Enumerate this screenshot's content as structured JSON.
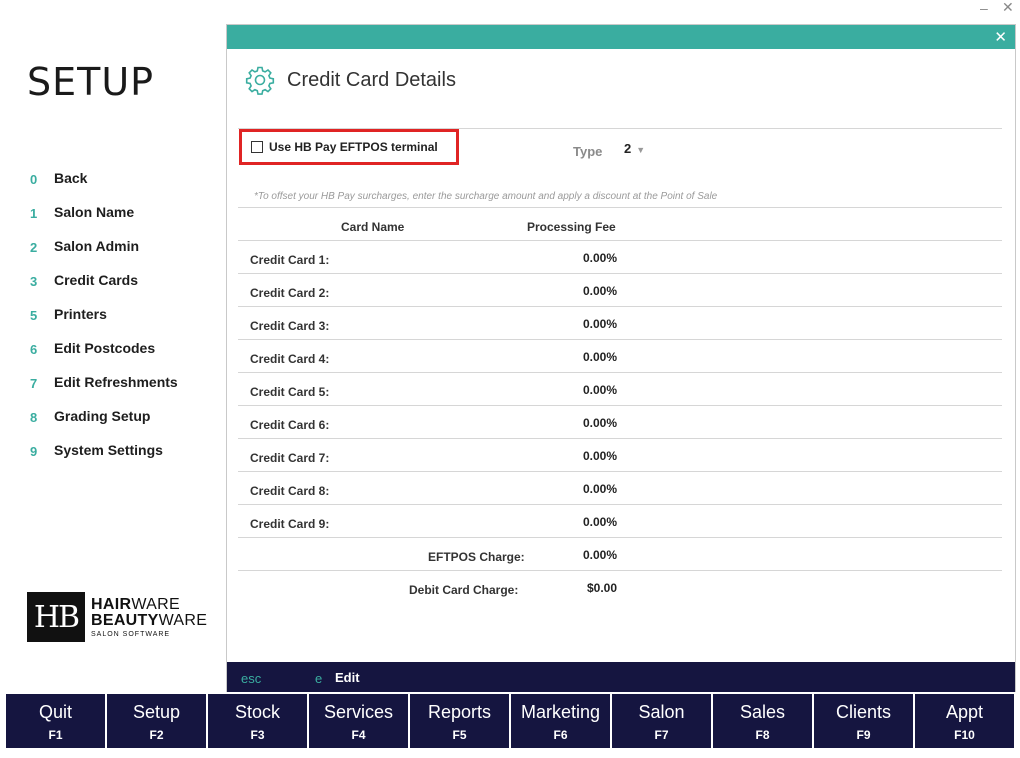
{
  "window": {
    "minimize_glyph": "–",
    "close_glyph": "✕"
  },
  "sidebar": {
    "title": "SETUP",
    "items": [
      {
        "key": "0",
        "label": "Back"
      },
      {
        "key": "1",
        "label": "Salon Name"
      },
      {
        "key": "2",
        "label": "Salon Admin"
      },
      {
        "key": "3",
        "label": "Credit Cards"
      },
      {
        "key": "5",
        "label": "Printers"
      },
      {
        "key": "6",
        "label": "Edit Postcodes"
      },
      {
        "key": "7",
        "label": "Edit Refreshments"
      },
      {
        "key": "8",
        "label": "Grading Setup"
      },
      {
        "key": "9",
        "label": "System Settings"
      }
    ],
    "logo": {
      "mark": "HB",
      "line1_bold": "HAIR",
      "line1_rest": "WARE",
      "line2_bold": "BEAUTY",
      "line2_rest": "WARE",
      "line3": "SALON SOFTWARE"
    }
  },
  "dialog": {
    "title": "Credit Card Details",
    "icon": "gear-icon",
    "close_glyph": "✕",
    "eftpos_checkbox": {
      "label": "Use HB Pay EFTPOS terminal",
      "checked": false
    },
    "type": {
      "label": "Type",
      "value": "2"
    },
    "note": "*To offset your HB Pay surcharges, enter the surcharge amount and apply a discount at the Point of Sale",
    "columns": {
      "card_name": "Card Name",
      "processing_fee": "Processing Fee"
    },
    "cards": [
      {
        "name": "Credit Card 1:",
        "fee": "0.00%"
      },
      {
        "name": "Credit Card 2:",
        "fee": "0.00%"
      },
      {
        "name": "Credit Card 3:",
        "fee": "0.00%"
      },
      {
        "name": "Credit Card 4:",
        "fee": "0.00%"
      },
      {
        "name": "Credit Card 5:",
        "fee": "0.00%"
      },
      {
        "name": "Credit Card 6:",
        "fee": "0.00%"
      },
      {
        "name": "Credit Card 7:",
        "fee": "0.00%"
      },
      {
        "name": "Credit Card 8:",
        "fee": "0.00%"
      },
      {
        "name": "Credit Card 9:",
        "fee": "0.00%"
      }
    ],
    "eftpos_charge": {
      "label": "EFTPOS Charge:",
      "value": "0.00%"
    },
    "debit_charge": {
      "label": "Debit Card Charge:",
      "value": "$0.00"
    },
    "footer": {
      "esc_key": "esc",
      "edit_key": "e",
      "edit_label": "Edit"
    }
  },
  "function_keys": [
    {
      "label": "Quit",
      "key": "F1"
    },
    {
      "label": "Setup",
      "key": "F2"
    },
    {
      "label": "Stock",
      "key": "F3"
    },
    {
      "label": "Services",
      "key": "F4"
    },
    {
      "label": "Reports",
      "key": "F5"
    },
    {
      "label": "Marketing",
      "key": "F6"
    },
    {
      "label": "Salon",
      "key": "F7"
    },
    {
      "label": "Sales",
      "key": "F8"
    },
    {
      "label": "Clients",
      "key": "F9"
    },
    {
      "label": "Appt",
      "key": "F10"
    }
  ],
  "colors": {
    "accent": "#3aada0",
    "navy": "#151540",
    "highlight": "#e02424"
  }
}
